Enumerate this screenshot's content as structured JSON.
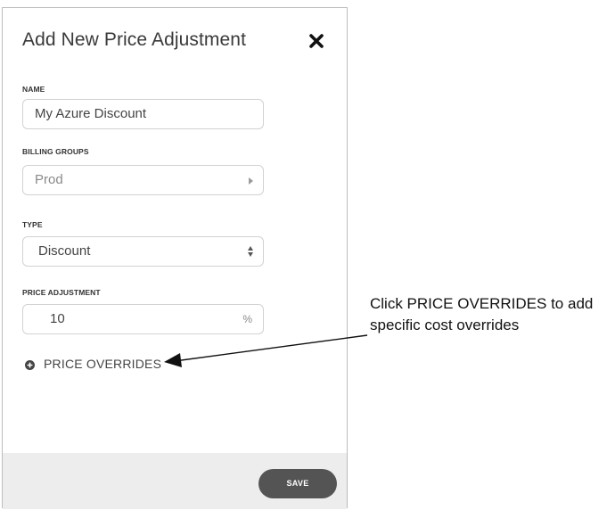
{
  "dialog": {
    "title": "Add New Price Adjustment",
    "close_icon": "close-icon"
  },
  "fields": {
    "name": {
      "label": "NAME",
      "value": "My Azure Discount"
    },
    "billing_groups": {
      "label": "BILLING GROUPS",
      "placeholder": "Prod"
    },
    "type": {
      "label": "TYPE",
      "value": "Discount"
    },
    "price_adjustment": {
      "label": "PRICE ADJUSTMENT",
      "value": "10",
      "unit": "%"
    }
  },
  "price_overrides": {
    "label": "PRICE OVERRIDES",
    "icon": "plus-circle-icon"
  },
  "footer": {
    "save_label": "SAVE"
  },
  "annotation": {
    "text": "Click PRICE OVERRIDES to add specific cost overrides"
  },
  "colors": {
    "save_button": "#545454",
    "footer_bg": "#ededed",
    "field_border": "#d2d2d2"
  }
}
